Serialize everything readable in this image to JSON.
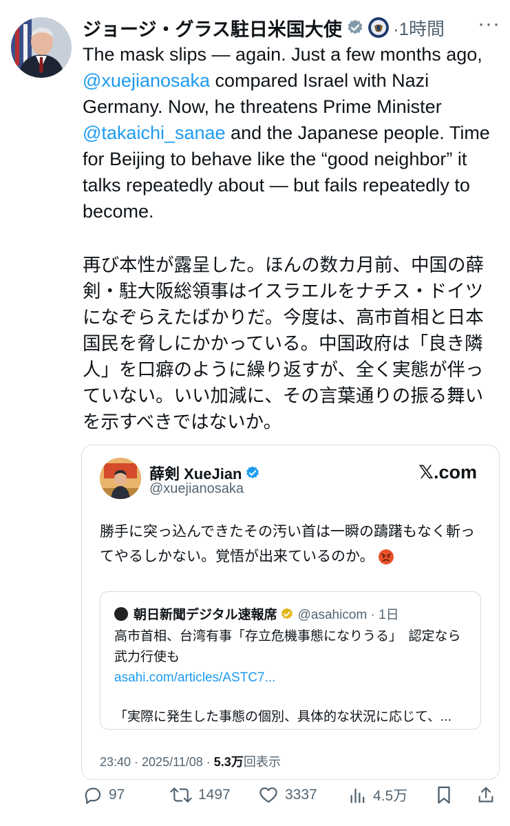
{
  "post": {
    "author": "ジョージ・グラス駐日米国大使",
    "time": "·1時間",
    "more": "···",
    "text_en_p1": "The mask slips — again. Just a few months ago, ",
    "mention1": "@xuejianosaka",
    "text_en_p2": " compared Israel with Nazi Germany. Now, he threatens Prime Minister ",
    "mention2": "@takaichi_sanae",
    "text_en_p3": " and the Japanese people. Time for Beijing to behave like the “good neighbor” it talks repeatedly about — but fails repeatedly to become.",
    "text_ja": "再び本性が露呈した。ほんの数カ月前、中国の薛剣・駐大阪総領事はイスラエルをナチス・ドイツになぞらえたばかりだ。今度は、高市首相と日本国民を脅しにかかっている。中国政府は「良き隣人」を口癖のように繰り返すが、全く実態が伴っていない。いい加減に、その言葉通りの振る舞いを示すべきではないか。"
  },
  "embedded": {
    "name": "薛剣 XueJian",
    "handle": "@xuejianosaka",
    "brand": "𝕏.com",
    "text": "勝手に突っ込んできたその汚い首は一瞬の躊躇もなく斬ってやるしかない。覚悟が出来ているのか。",
    "quote": {
      "name": "朝日新聞デジタル速報席",
      "handle_time": "@asahicom · 1日",
      "title": "高市首相、台湾有事「存立危機事態になりうる」　認定なら武力行使も",
      "link": "asahi.com/articles/ASTC7...",
      "excerpt": "「実際に発生した事態の個別、具体的な状況に応じて、..."
    },
    "meta_time": "23:40 · 2025/11/08 · ",
    "meta_views": "5.3万",
    "meta_views_label": "回表示"
  },
  "actions": {
    "replies": "97",
    "reposts": "1497",
    "likes": "3337",
    "views": "4.5万"
  },
  "colors": {
    "accent": "#1d9bf0",
    "secondary": "#536471",
    "text": "#0f1419"
  }
}
